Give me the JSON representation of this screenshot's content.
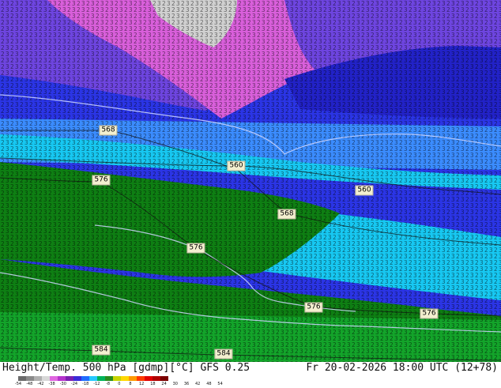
{
  "map": {
    "contour_labels": [
      "568",
      "576",
      "560",
      "560",
      "568",
      "576",
      "576",
      "576",
      "584",
      "584"
    ]
  },
  "footer": {
    "title_left": "Height/Temp. 500 hPa [gdmp][°C] GFS 0.25",
    "title_right": "Fr 20-02-2026 18:00 UTC (12+78)"
  },
  "colorbar": {
    "ticks": [
      "-54",
      "-48",
      "-42",
      "-38",
      "-30",
      "-24",
      "-18",
      "-12",
      "-8",
      "0",
      "8",
      "12",
      "18",
      "24",
      "30",
      "36",
      "42",
      "48",
      "54"
    ],
    "colors": [
      "#6a6a6a",
      "#8a8a8a",
      "#b0b0b0",
      "#d8d8d8",
      "#e066e0",
      "#b533cc",
      "#7a1fb0",
      "#3a2ad8",
      "#1e6cff",
      "#25c8ff",
      "#00b35a",
      "#2a8a1c",
      "#c8d400",
      "#ffd800",
      "#ff9a00",
      "#ff3a00",
      "#e00000",
      "#b00000",
      "#7a0000"
    ]
  },
  "legend_colors": {
    "cold_gray": "#cccccc",
    "magenta": "#d65fd6",
    "purple": "#8a3fd0",
    "blue": "#2a2ae0",
    "light_blue": "#3a8dff",
    "cyan": "#14d2f5",
    "green_light": "#0f9a1e",
    "green": "#0b7a12"
  }
}
